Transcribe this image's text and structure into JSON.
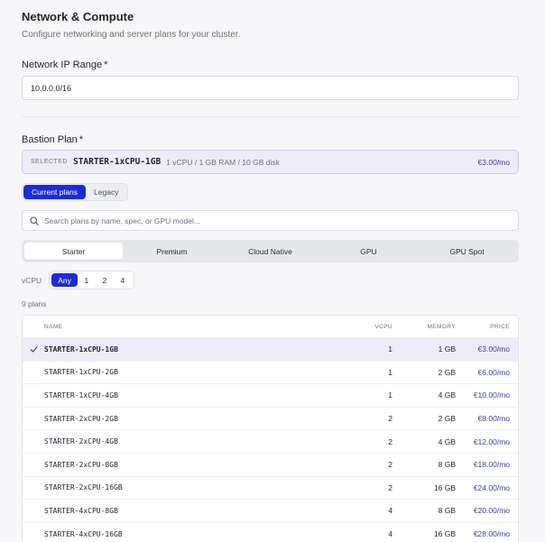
{
  "section": {
    "title": "Network & Compute",
    "subtitle": "Configure networking and server plans for your cluster."
  },
  "network": {
    "label": "Network IP Range",
    "required_mark": "*",
    "value": "10.0.0.0/16"
  },
  "bastion": {
    "label": "Bastion Plan",
    "required_mark": "*",
    "selected_tag": "SELECTED",
    "selected_name": "STARTER-1xCPU-1GB",
    "selected_spec": "1 vCPU / 1 GB RAM / 10 GB disk",
    "selected_price": "€3.00/mo"
  },
  "plan_toggle": {
    "current": "Current plans",
    "legacy": "Legacy"
  },
  "search": {
    "placeholder": "Search plans by name, spec, or GPU model..."
  },
  "categories": [
    "Starter",
    "Premium",
    "Cloud Native",
    "GPU",
    "GPU Spot"
  ],
  "vcpu_filter": {
    "label": "vCPU",
    "options": [
      "Any",
      "1",
      "2",
      "4"
    ]
  },
  "plans_count": "9 plans",
  "table": {
    "headers": {
      "name": "NAME",
      "vcpu": "VCPU",
      "memory": "MEMORY",
      "price": "PRICE"
    },
    "rows": [
      {
        "name": "STARTER-1xCPU-1GB",
        "vcpu": "1",
        "memory": "1 GB",
        "price": "€3.00/mo"
      },
      {
        "name": "STARTER-1xCPU-2GB",
        "vcpu": "1",
        "memory": "2 GB",
        "price": "€6.00/mo"
      },
      {
        "name": "STARTER-1xCPU-4GB",
        "vcpu": "1",
        "memory": "4 GB",
        "price": "€10.00/mo"
      },
      {
        "name": "STARTER-2xCPU-2GB",
        "vcpu": "2",
        "memory": "2 GB",
        "price": "€8.00/mo"
      },
      {
        "name": "STARTER-2xCPU-4GB",
        "vcpu": "2",
        "memory": "4 GB",
        "price": "€12.00/mo"
      },
      {
        "name": "STARTER-2xCPU-8GB",
        "vcpu": "2",
        "memory": "8 GB",
        "price": "€18.00/mo"
      },
      {
        "name": "STARTER-2xCPU-16GB",
        "vcpu": "2",
        "memory": "16 GB",
        "price": "€24.00/mo"
      },
      {
        "name": "STARTER-4xCPU-8GB",
        "vcpu": "4",
        "memory": "8 GB",
        "price": "€20.00/mo"
      },
      {
        "name": "STARTER-4xCPU-16GB",
        "vcpu": "4",
        "memory": "16 GB",
        "price": "€28.00/mo"
      }
    ]
  },
  "colors": {
    "accent": "#1d2bd4",
    "selected_bg": "#eeecf8",
    "price": "#3b3f9a"
  },
  "icons": {
    "search": "search-icon",
    "check": "check-icon"
  }
}
